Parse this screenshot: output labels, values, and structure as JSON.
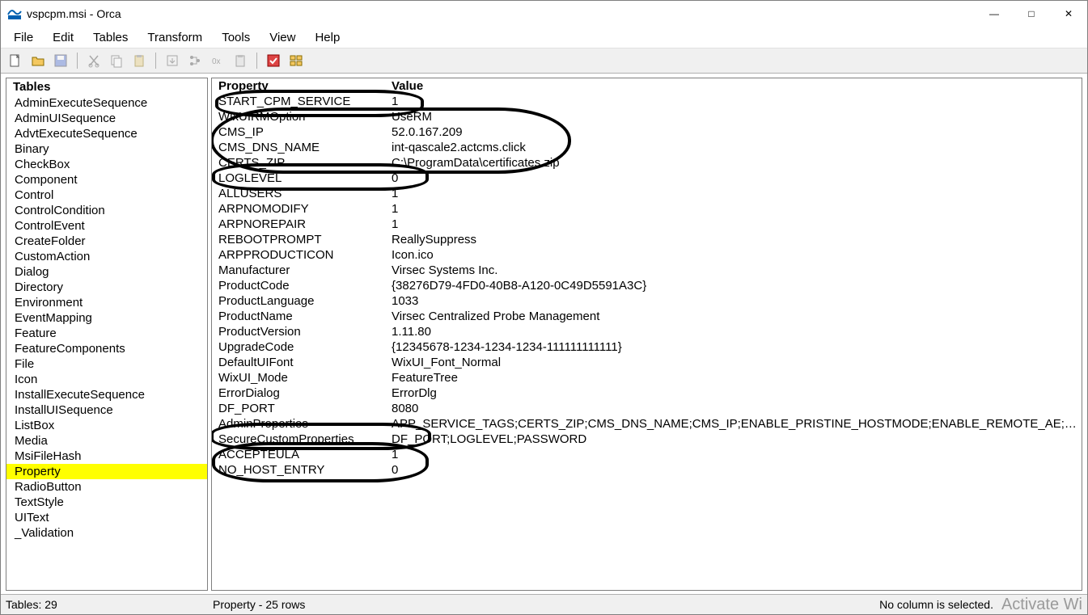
{
  "title": "vspcpm.msi - Orca",
  "menus": [
    "File",
    "Edit",
    "Tables",
    "Transform",
    "Tools",
    "View",
    "Help"
  ],
  "toolbar_icons": [
    {
      "name": "new-file-icon",
      "disabled": false
    },
    {
      "name": "open-file-icon",
      "disabled": false
    },
    {
      "name": "save-file-icon",
      "disabled": true
    },
    {
      "sep": true
    },
    {
      "name": "cut-icon",
      "disabled": true
    },
    {
      "name": "copy-icon",
      "disabled": true
    },
    {
      "name": "paste-icon",
      "disabled": true
    },
    {
      "sep": true
    },
    {
      "name": "import-icon",
      "disabled": true
    },
    {
      "name": "tree-icon",
      "disabled": true
    },
    {
      "name": "hex-icon",
      "disabled": true
    },
    {
      "name": "paste2-icon",
      "disabled": true
    },
    {
      "sep": true
    },
    {
      "name": "validate-icon",
      "disabled": false
    },
    {
      "name": "schema-icon",
      "disabled": false
    }
  ],
  "left": {
    "header": "Tables",
    "items": [
      "AdminExecuteSequence",
      "AdminUISequence",
      "AdvtExecuteSequence",
      "Binary",
      "CheckBox",
      "Component",
      "Control",
      "ControlCondition",
      "ControlEvent",
      "CreateFolder",
      "CustomAction",
      "Dialog",
      "Directory",
      "Environment",
      "EventMapping",
      "Feature",
      "FeatureComponents",
      "File",
      "Icon",
      "InstallExecuteSequence",
      "InstallUISequence",
      "ListBox",
      "Media",
      "MsiFileHash",
      "Property",
      "RadioButton",
      "TextStyle",
      "UIText",
      "_Validation"
    ],
    "selected_index": 24
  },
  "grid": {
    "columns": [
      "Property",
      "Value"
    ],
    "rows": [
      {
        "p": "START_CPM_SERVICE",
        "v": "1"
      },
      {
        "p": "WixUIRMOption",
        "v": "UseRM"
      },
      {
        "p": "CMS_IP",
        "v": "52.0.167.209"
      },
      {
        "p": "CMS_DNS_NAME",
        "v": "int-qascale2.actcms.click"
      },
      {
        "p": "CERTS_ZIP",
        "v": "C:\\ProgramData\\certificates.zip"
      },
      {
        "p": "LOGLEVEL",
        "v": "0"
      },
      {
        "p": "ALLUSERS",
        "v": "1"
      },
      {
        "p": "ARPNOMODIFY",
        "v": "1"
      },
      {
        "p": "ARPNOREPAIR",
        "v": "1"
      },
      {
        "p": "REBOOTPROMPT",
        "v": "ReallySuppress"
      },
      {
        "p": "ARPPRODUCTICON",
        "v": "Icon.ico"
      },
      {
        "p": "Manufacturer",
        "v": "Virsec Systems Inc."
      },
      {
        "p": "ProductCode",
        "v": "{38276D79-4FD0-40B8-A120-0C49D5591A3C}"
      },
      {
        "p": "ProductLanguage",
        "v": "1033"
      },
      {
        "p": "ProductName",
        "v": "Virsec Centralized Probe Management"
      },
      {
        "p": "ProductVersion",
        "v": "1.11.80"
      },
      {
        "p": "UpgradeCode",
        "v": "{12345678-1234-1234-1234-111111111111}"
      },
      {
        "p": "DefaultUIFont",
        "v": "WixUI_Font_Normal"
      },
      {
        "p": "WixUI_Mode",
        "v": "FeatureTree"
      },
      {
        "p": "ErrorDialog",
        "v": "ErrorDlg"
      },
      {
        "p": "DF_PORT",
        "v": "8080"
      },
      {
        "p": "AdminProperties",
        "v": "APP_SERVICE_TAGS;CERTS_ZIP;CMS_DNS_NAME;CMS_IP;ENABLE_PRISTINE_HOSTMODE;ENABLE_REMOTE_AE;HELP;HIDE_VSP_I..."
      },
      {
        "p": "SecureCustomProperties",
        "v": "DF_PORT;LOGLEVEL;PASSWORD"
      },
      {
        "p": "ACCEPTEULA",
        "v": "1"
      },
      {
        "p": "NO_HOST_ENTRY",
        "v": "0"
      }
    ]
  },
  "status": {
    "tables": "Tables: 29",
    "rows": "Property - 25 rows",
    "column": "No column is selected."
  },
  "watermark": "Activate Wi"
}
